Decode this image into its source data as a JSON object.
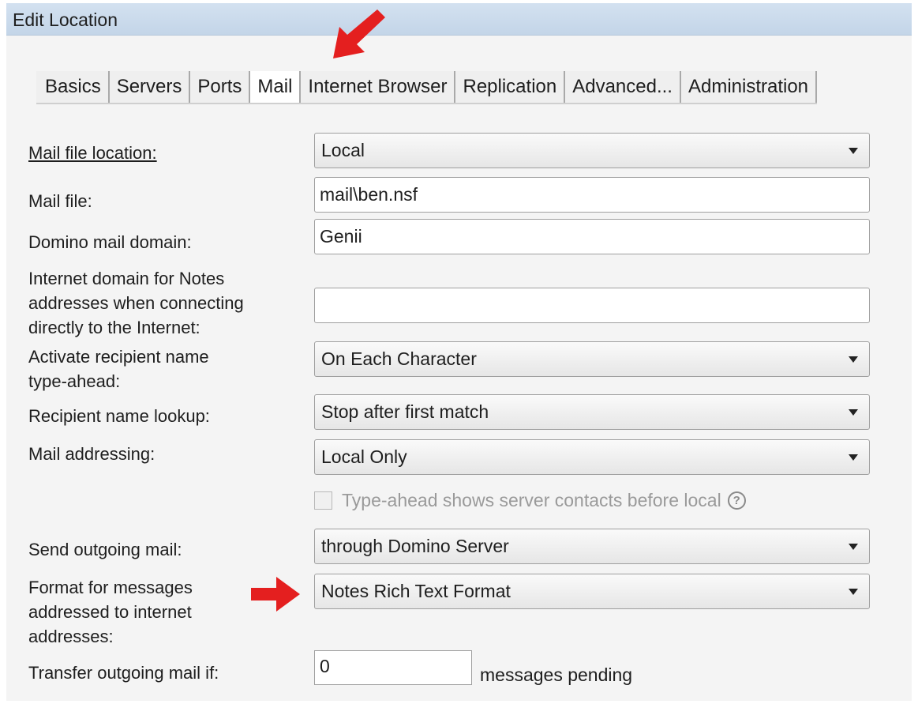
{
  "window": {
    "title": "Edit Location"
  },
  "tabs": [
    {
      "label": "Basics"
    },
    {
      "label": "Servers"
    },
    {
      "label": "Ports"
    },
    {
      "label": "Mail",
      "active": true
    },
    {
      "label": "Internet Browser"
    },
    {
      "label": "Replication"
    },
    {
      "label": "Advanced..."
    },
    {
      "label": "Administration"
    }
  ],
  "form": {
    "mail_file_location": {
      "label": "Mail file location:",
      "value": "Local"
    },
    "mail_file": {
      "label": "Mail file:",
      "value": "mail\\ben.nsf"
    },
    "domino_mail_domain": {
      "label": "Domino mail domain:",
      "value": "Genii"
    },
    "internet_domain": {
      "label_lines": [
        "Internet domain for Notes",
        "addresses when connecting",
        "directly to the Internet:"
      ],
      "value": ""
    },
    "type_ahead": {
      "label_lines": [
        "Activate recipient name",
        "type-ahead:"
      ],
      "value": "On Each Character"
    },
    "name_lookup": {
      "label": "Recipient name lookup:",
      "value": "Stop after first match"
    },
    "mail_addressing": {
      "label": "Mail addressing:",
      "value": "Local Only"
    },
    "server_contacts_checkbox": {
      "label": "Type-ahead shows server contacts before local",
      "checked": false,
      "help_glyph": "?"
    },
    "send_outgoing": {
      "label": "Send outgoing mail:",
      "value": "through Domino Server"
    },
    "internet_format": {
      "label_lines": [
        "Format for messages",
        "addressed to internet",
        "addresses:"
      ],
      "value": "Notes Rich Text Format"
    },
    "transfer_outgoing": {
      "label": "Transfer outgoing mail if:",
      "value": "0",
      "suffix": "messages pending"
    }
  },
  "colors": {
    "arrow": "#e41f1f",
    "titlebar": "#c9dbee"
  },
  "icons": {
    "select_arrow": "chevron-down-icon",
    "help": "help-circle-icon"
  }
}
